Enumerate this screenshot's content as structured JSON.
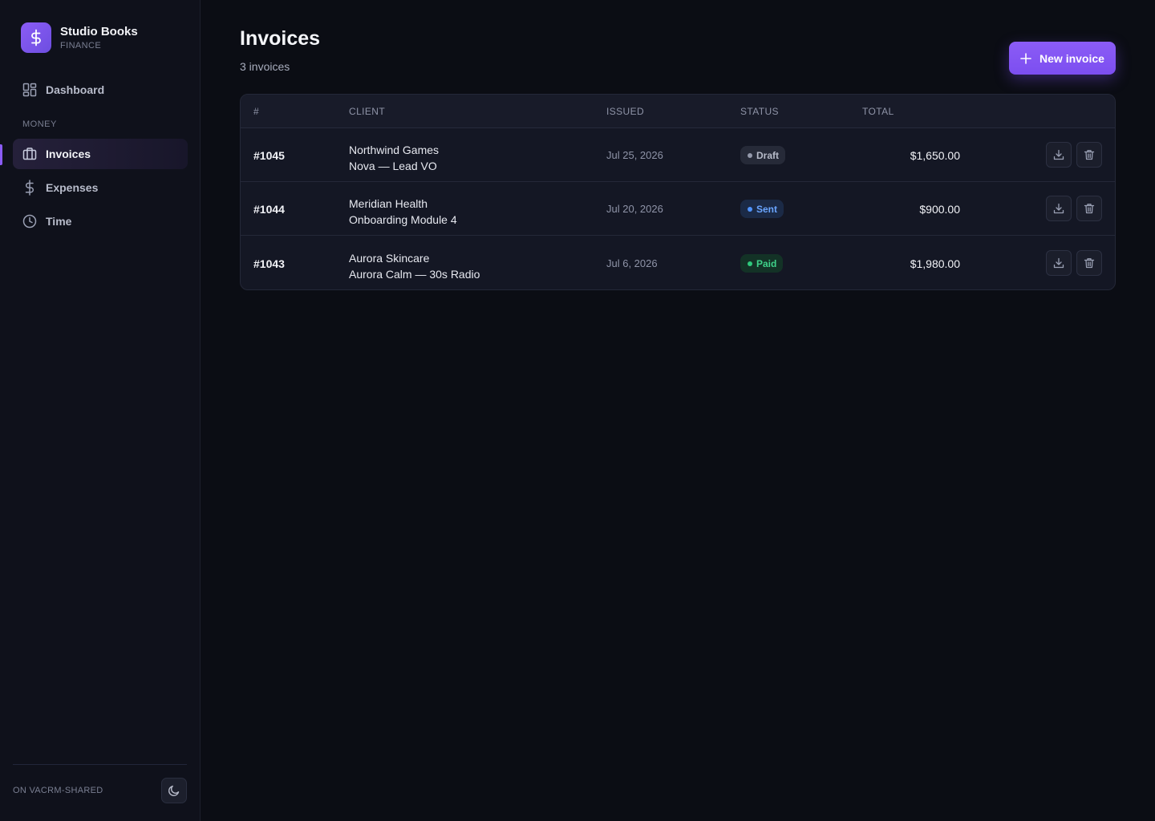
{
  "brand": {
    "name": "Studio Books",
    "subtitle": "FINANCE",
    "logo_icon": "dollar-icon",
    "accent": "#8b5cf6"
  },
  "sidebar": {
    "items": [
      {
        "label": "Dashboard",
        "icon": "grid-icon"
      },
      {
        "label": "Invoices",
        "icon": "briefcase-icon",
        "active": true
      },
      {
        "label": "Expenses",
        "icon": "dollar-icon"
      },
      {
        "label": "Time",
        "icon": "clock-icon"
      }
    ],
    "section_label": "MONEY",
    "workspace": "ON VACRM-SHARED",
    "theme_icon": "moon-icon"
  },
  "header": {
    "title": "Invoices",
    "subtitle": "3 invoices",
    "new_button": "New invoice"
  },
  "table": {
    "columns": [
      "#",
      "CLIENT",
      "ISSUED",
      "STATUS",
      "TOTAL"
    ],
    "rows": [
      {
        "id": "#1045",
        "client": "Northwind Games",
        "project": "Nova — Lead VO",
        "issued": "Jul 25, 2026",
        "status": "Draft",
        "total": "$1,650.00"
      },
      {
        "id": "#1044",
        "client": "Meridian Health",
        "project": "Onboarding Module 4",
        "issued": "Jul 20, 2026",
        "status": "Sent",
        "total": "$900.00"
      },
      {
        "id": "#1043",
        "client": "Aurora Skincare",
        "project": "Aurora Calm — 30s Radio",
        "issued": "Jul 6, 2026",
        "status": "Paid",
        "total": "$1,980.00"
      }
    ]
  },
  "status_colors": {
    "Draft": "#9499ab",
    "Sent": "#4f93ff",
    "Paid": "#2ec97c"
  }
}
